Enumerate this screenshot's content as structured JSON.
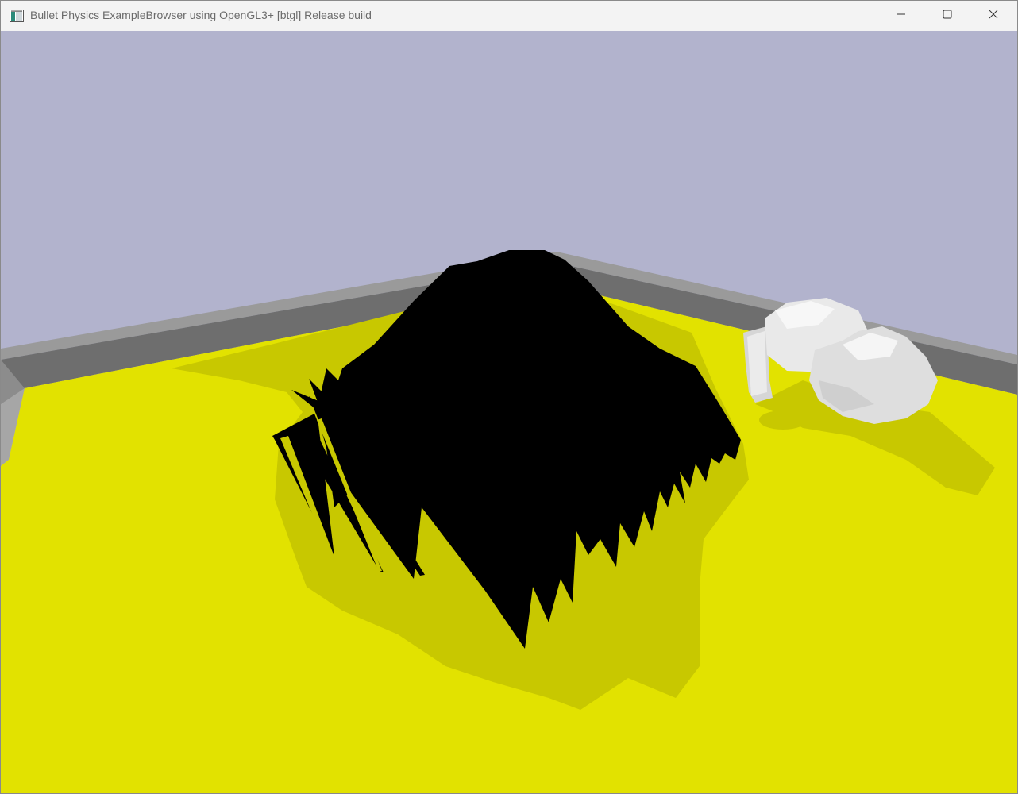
{
  "window": {
    "title": "Bullet Physics ExampleBrowser using OpenGL3+ [btgl] Release build",
    "icon": "app-window-icon",
    "controls": {
      "minimize_icon": "minimize-icon",
      "maximize_icon": "maximize-icon",
      "close_icon": "close-icon"
    }
  },
  "scene": {
    "sky_color": "#b2b3cd",
    "floor_color": "#e2e200",
    "floor_shadow_color": "#c8c800",
    "wall_color": "#6e6e6e",
    "wall_top_color": "#9a9a9a",
    "soft_body_color": "#000000",
    "rigid_body_color": "#e6e6e6"
  }
}
